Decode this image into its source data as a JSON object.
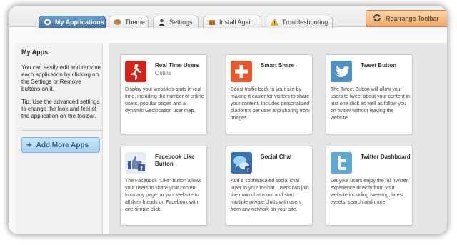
{
  "tabs": [
    {
      "label": "My Applications",
      "icon": "gear-icon",
      "active": true
    },
    {
      "label": "Theme",
      "icon": "palette-icon",
      "active": false
    },
    {
      "label": "Settings",
      "icon": "user-icon",
      "active": false
    },
    {
      "label": "Install Again",
      "icon": "box-icon",
      "active": false
    },
    {
      "label": "Troubleshooting",
      "icon": "warning-icon",
      "active": false
    }
  ],
  "rearrange": {
    "label": "Rearrange Toolbar",
    "icon": "refresh-icon"
  },
  "sidebar": {
    "title": "My Apps",
    "description": "You can easily edit and remove each application by clicking on the Settings or Remove buttons on it.",
    "tip": "Tip: Use the advanced settings to change the look and feel of the application on the toolbar.",
    "add_button": "Add More Apps"
  },
  "apps": [
    {
      "title": "Real Time Users",
      "status": "Online",
      "icon": "runner-icon",
      "color": "#d3231d",
      "description": "Display your website's stats in real time, including the number of online users, popular pages and a dynamic Geolocation user map."
    },
    {
      "title": "Smart Share",
      "status": "",
      "icon": "plus-icon",
      "color": "#e8572c",
      "description": "Boost traffic back to your site by making it easier for visitors to share your content. Includes personalized platforms per user and sharing from images."
    },
    {
      "title": "Tweet Button",
      "status": "",
      "icon": "twitter-bird-icon",
      "color": "#4f8fc4",
      "description": "The Tweet Button will allow your users to tweet about your content in just one click as well as follow you on twitter without leaving the website."
    },
    {
      "title": "Facebook Like Button",
      "status": "",
      "icon": "facebook-like-icon",
      "color": "#3b5998",
      "description": "The Facebook \"Like\" button allows your users to share your content from any page on your website to all their friends on Facebook with one simple click."
    },
    {
      "title": "Social Chat",
      "status": "",
      "icon": "chat-bubbles-icon",
      "color": "#3a6fb0",
      "description": "Add a sophisticated social chat layer to your toolbar. Users can join the main chat room and start multiple private chats with users from any network on your site."
    },
    {
      "title": "Twitter Dashboard",
      "status": "",
      "icon": "twitter-t-icon",
      "color": "#5fa8d3",
      "description": "Let your users enjoy the full Twitter experience directly from your website including tweeting, latest tweets, search and more."
    }
  ]
}
